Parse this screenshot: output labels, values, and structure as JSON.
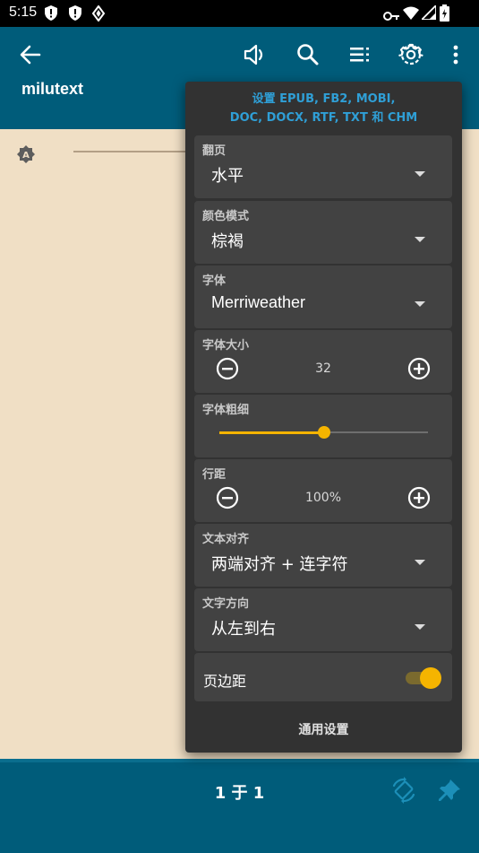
{
  "status_bar": {
    "time": "5:15"
  },
  "app_bar": {
    "title": "milutext",
    "icons": [
      "back-arrow-icon",
      "speaker-icon",
      "search-icon",
      "playlist-icon",
      "gear-icon",
      "more-vertical-icon"
    ]
  },
  "bottom_bar": {
    "pager": "1 于 1"
  },
  "panel": {
    "header_line1": "设置 EPUB, FB2, MOBI,",
    "header_line2": "DOC, DOCX, RTF, TXT 和 CHM",
    "page_turn": {
      "label": "翻页",
      "value": "水平"
    },
    "color_mode": {
      "label": "颜色模式",
      "value": "棕褐"
    },
    "font": {
      "label": "字体",
      "value": "Merriweather"
    },
    "font_size": {
      "label": "字体大小",
      "value": "32"
    },
    "font_weight": {
      "label": "字体粗细",
      "slider_fraction": 0.5
    },
    "line_spacing": {
      "label": "行距",
      "value": "100%"
    },
    "text_align": {
      "label": "文本对齐",
      "value": "两端对齐 + 连字符"
    },
    "text_direction": {
      "label": "文字方向",
      "value": "从左到右"
    },
    "margins": {
      "label": "页边距",
      "enabled": true
    },
    "general_settings": "通用设置"
  },
  "colors": {
    "app_bar": "#005c7a",
    "page_background": "#f0dfc5",
    "panel": "#323232",
    "card": "#424242",
    "accent": "#f5b400",
    "header_text": "#2f9fd6"
  }
}
